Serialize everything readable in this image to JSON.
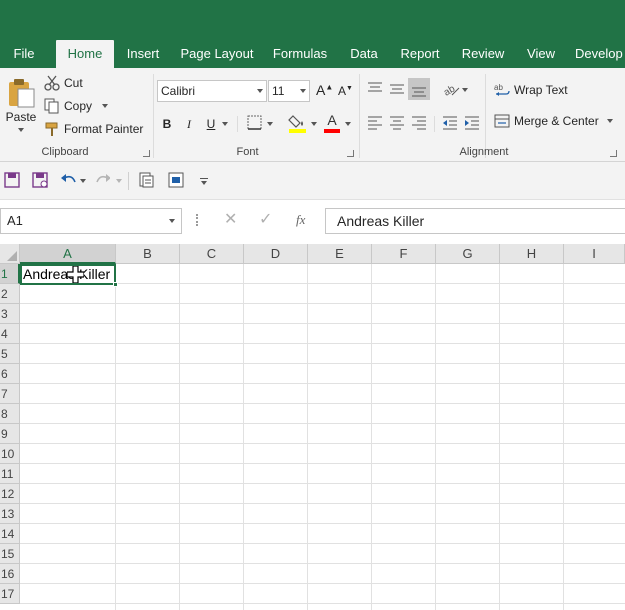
{
  "ribbon_tabs": [
    {
      "label": "File"
    },
    {
      "label": "Home"
    },
    {
      "label": "Insert"
    },
    {
      "label": "Page Layout"
    },
    {
      "label": "Formulas"
    },
    {
      "label": "Data"
    },
    {
      "label": "Report"
    },
    {
      "label": "Review"
    },
    {
      "label": "View"
    },
    {
      "label": "Develop"
    }
  ],
  "active_tab": "Home",
  "clipboard": {
    "paste_label": "Paste",
    "cut_label": "Cut",
    "copy_label": "Copy",
    "format_painter_label": "Format Painter",
    "group_label": "Clipboard"
  },
  "font": {
    "font_name": "Calibri",
    "font_size": "11",
    "bold": "B",
    "italic": "I",
    "underline": "U",
    "font_color_letter": "A",
    "highlight_color": "#ffff00",
    "font_color": "#ff0000",
    "group_label": "Font"
  },
  "alignment": {
    "wrap_text_label": "Wrap Text",
    "merge_center_label": "Merge & Center",
    "group_label": "Alignment"
  },
  "formula_bar": {
    "name_box": "A1",
    "formula_value": "Andreas Killer",
    "fx_label": "fx"
  },
  "grid": {
    "columns": [
      "A",
      "B",
      "C",
      "D",
      "E",
      "F",
      "G",
      "H",
      "I"
    ],
    "rows": [
      "1",
      "2",
      "3",
      "4",
      "5",
      "6",
      "7",
      "8",
      "9",
      "10",
      "11",
      "12",
      "13",
      "14",
      "15",
      "16",
      "17"
    ],
    "selected_column": "A",
    "selected_row": "1",
    "cell_a1": "Andreas Killer"
  },
  "colors": {
    "accent": "#217346",
    "ribbon_bg": "#f3f3f3"
  }
}
